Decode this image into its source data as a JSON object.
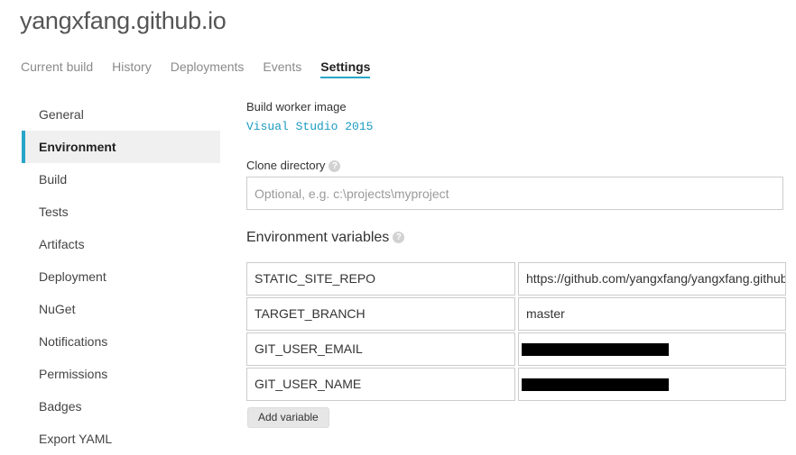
{
  "project": {
    "title": "yangxfang.github.io"
  },
  "tabs": [
    {
      "label": "Current build",
      "active": false
    },
    {
      "label": "History",
      "active": false
    },
    {
      "label": "Deployments",
      "active": false
    },
    {
      "label": "Events",
      "active": false
    },
    {
      "label": "Settings",
      "active": true
    }
  ],
  "sidebar": {
    "items": [
      {
        "label": "General",
        "active": false
      },
      {
        "label": "Environment",
        "active": true
      },
      {
        "label": "Build",
        "active": false
      },
      {
        "label": "Tests",
        "active": false
      },
      {
        "label": "Artifacts",
        "active": false
      },
      {
        "label": "Deployment",
        "active": false
      },
      {
        "label": "NuGet",
        "active": false
      },
      {
        "label": "Notifications",
        "active": false
      },
      {
        "label": "Permissions",
        "active": false
      },
      {
        "label": "Badges",
        "active": false
      },
      {
        "label": "Export YAML",
        "active": false
      }
    ]
  },
  "form": {
    "build_worker_image_label": "Build worker image",
    "build_worker_image_value": "Visual Studio 2015",
    "clone_directory_label": "Clone directory",
    "clone_directory_value": "",
    "clone_directory_placeholder": "Optional, e.g. c:\\projects\\myproject",
    "help_glyph": "?",
    "env_section_title": "Environment variables",
    "env_vars": [
      {
        "name": "STATIC_SITE_REPO",
        "value": "https://github.com/yangxfang/yangxfang.github.io",
        "redacted": false
      },
      {
        "name": "TARGET_BRANCH",
        "value": "master",
        "redacted": false
      },
      {
        "name": "GIT_USER_EMAIL",
        "value": "",
        "redacted": true
      },
      {
        "name": "GIT_USER_NAME",
        "value": "",
        "redacted": true
      }
    ],
    "add_variable_label": "Add variable"
  },
  "colors": {
    "accent": "#27a5c8",
    "link": "#1a9bc0",
    "redaction": "#000000"
  },
  "icons": {
    "help": "help-icon"
  }
}
